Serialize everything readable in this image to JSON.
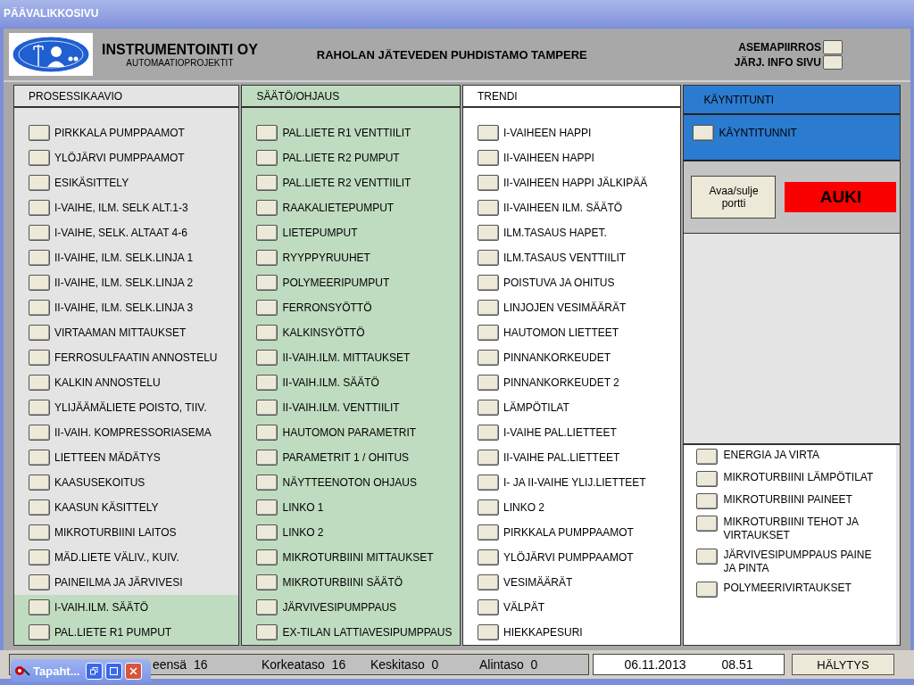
{
  "window": {
    "title": "PÄÄVALIKKOSIVU"
  },
  "header": {
    "company": "INSTRUMENTOINTI OY",
    "subtitle": "AUTOMAATIOPROJEKTIT",
    "plant": "RAHOLAN  JÄTEVEDEN PUHDISTAMO TAMPERE",
    "links": [
      "ASEMAPIIRROS",
      "JÄRJ. INFO SIVU"
    ]
  },
  "columns": [
    {
      "title": "PROSESSIKAAVIO",
      "items": [
        {
          "label": "PIRKKALA PUMPPAAMOT",
          "color": "#e4e4e4"
        },
        {
          "label": "YLÖJÄRVI PUMPPAAMOT",
          "color": "#e4e4e4"
        },
        {
          "label": "ESIKÄSITTELY",
          "color": "#e4e4e4"
        },
        {
          "label": "I-VAIHE, ILM. SELK ALT.1-3",
          "color": "#e4e4e4"
        },
        {
          "label": "I-VAIHE, SELK. ALTAAT 4-6",
          "color": "#e4e4e4"
        },
        {
          "label": "II-VAIHE, ILM. SELK.LINJA 1",
          "color": "#e4e4e4"
        },
        {
          "label": "II-VAIHE, ILM. SELK.LINJA 2",
          "color": "#e4e4e4"
        },
        {
          "label": "II-VAIHE, ILM. SELK.LINJA 3",
          "color": "#e4e4e4"
        },
        {
          "label": "VIRTAAMAN MITTAUKSET",
          "color": "#e4e4e4"
        },
        {
          "label": "FERROSULFAATIN ANNOSTELU",
          "color": "#e4e4e4"
        },
        {
          "label": "KALKIN ANNOSTELU",
          "color": "#e4e4e4"
        },
        {
          "label": "YLIJÄÄMÄLIETE POISTO, TIIV.",
          "color": "#e4e4e4"
        },
        {
          "label": "II-VAIH. KOMPRESSORIASEMA",
          "color": "#e4e4e4"
        },
        {
          "label": "LIETTEEN MÄDÄTYS",
          "color": "#e4e4e4"
        },
        {
          "label": "KAASUSEKOITUS",
          "color": "#e4e4e4"
        },
        {
          "label": "KAASUN KÄSITTELY",
          "color": "#e4e4e4"
        },
        {
          "label": "MIKROTURBIINI LAITOS",
          "color": "#e4e4e4"
        },
        {
          "label": "MÄD.LIETE VÄLIV., KUIV.",
          "color": "#e4e4e4"
        },
        {
          "label": "PAINEILMA JA JÄRVIVESI",
          "color": "#e4e4e4"
        },
        {
          "label": "I-VAIH.ILM. SÄÄTÖ",
          "color": "#c0dcc0"
        },
        {
          "label": "PAL.LIETE R1 PUMPUT",
          "color": "#c0dcc0"
        }
      ]
    },
    {
      "title": "SÄÄTÖ/OHJAUS",
      "items": [
        {
          "label": "PAL.LIETE R1 VENTTIILIT"
        },
        {
          "label": "PAL.LIETE R2 PUMPUT"
        },
        {
          "label": "PAL.LIETE R2 VENTTIILIT"
        },
        {
          "label": "RAAKALIETEPUMPUT"
        },
        {
          "label": "LIETEPUMPUT"
        },
        {
          "label": "RYYPPYRUUHET"
        },
        {
          "label": "POLYMEERIPUMPUT"
        },
        {
          "label": "FERRONSYÖTTÖ"
        },
        {
          "label": "KALKINSYÖTTÖ"
        },
        {
          "label": "II-VAIH.ILM. MITTAUKSET"
        },
        {
          "label": "II-VAIH.ILM. SÄÄTÖ"
        },
        {
          "label": "II-VAIH.ILM. VENTTIILIT"
        },
        {
          "label": "HAUTOMON PARAMETRIT"
        },
        {
          "label": "PARAMETRIT 1 / OHITUS"
        },
        {
          "label": "NÄYTTEENOTON OHJAUS"
        },
        {
          "label": "LINKO 1"
        },
        {
          "label": "LINKO 2"
        },
        {
          "label": "MIKROTURBIINI MITTAUKSET"
        },
        {
          "label": "MIKROTURBIINI SÄÄTÖ"
        },
        {
          "label": "JÄRVIVESIPUMPPAUS"
        },
        {
          "label": "EX-TILAN LATTIAVESIPUMPPAUS"
        }
      ]
    },
    {
      "title": "TRENDI",
      "items": [
        {
          "label": "I-VAIHEEN HAPPI"
        },
        {
          "label": "II-VAIHEEN HAPPI"
        },
        {
          "label": "II-VAIHEEN HAPPI JÄLKIPÄÄ"
        },
        {
          "label": "II-VAIHEEN ILM. SÄÄTÖ"
        },
        {
          "label": "ILM.TASAUS HAPET."
        },
        {
          "label": "ILM.TASAUS VENTTIILIT"
        },
        {
          "label": "POISTUVA JA OHITUS"
        },
        {
          "label": "LINJOJEN VESIMÄÄRÄT"
        },
        {
          "label": "HAUTOMON LIETTEET"
        },
        {
          "label": "PINNANKORKEUDET"
        },
        {
          "label": "PINNANKORKEUDET 2"
        },
        {
          "label": "LÄMPÖTILAT"
        },
        {
          "label": "I-VAIHE PAL.LIETTEET"
        },
        {
          "label": "II-VAIHE PAL.LIETTEET"
        },
        {
          "label": "I- JA II-VAIHE YLIJ.LIETTEET"
        },
        {
          "label": "LINKO 2"
        },
        {
          "label": "PIRKKALA PUMPPAAMOT"
        },
        {
          "label": "YLÖJÄRVI PUMPPAAMOT"
        },
        {
          "label": "VESIMÄÄRÄT"
        },
        {
          "label": "VÄLPÄT"
        },
        {
          "label": "HIEKKAPESURI"
        }
      ]
    }
  ],
  "runtime": {
    "title": "KÄYNTITUNTI",
    "items": [
      "KÄYNTITUNNIT"
    ],
    "gate_button": "Avaa/sulje portti",
    "gate_status": "AUKI"
  },
  "energy": {
    "items": [
      "ENERGIA JA VIRTA",
      "MIKROTURBIINI LÄMPÖTILAT",
      "MIKROTURBIINI PAINEET",
      "MIKROTURBIINI TEHOT JA VIRTAUKSET",
      "JÄRVIVESIPUMPPAUS PAINE JA PINTA",
      "POLYMEERIVIRTAUKSET"
    ]
  },
  "status_bar": {
    "counts": [
      "eensä  16",
      "Korkeataso  16",
      "Keskitaso  0",
      "Alintaso  0"
    ],
    "date": "06.11.2013",
    "time": "08.51",
    "alarm_button": "HÄLYTYS"
  },
  "minimized_window": {
    "title": "Tapaht..."
  }
}
